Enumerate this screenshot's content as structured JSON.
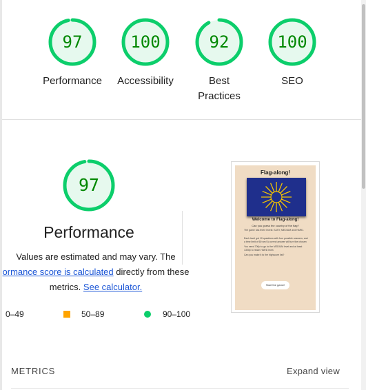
{
  "summary": {
    "gauges": [
      {
        "score": "97",
        "label": "Performance",
        "fraction": 0.97
      },
      {
        "score": "100",
        "label": "Accessibility",
        "fraction": 1.0
      },
      {
        "score": "92",
        "label": "Best Practices",
        "fraction": 0.92
      },
      {
        "score": "100",
        "label": "SEO",
        "fraction": 1.0
      }
    ]
  },
  "performance": {
    "score": "97",
    "fraction": 0.97,
    "title": "Performance",
    "desc_line1": "Values are estimated and may vary. The",
    "desc_link1": "ormance score is calculated",
    "desc_line2_rest": " directly from these",
    "desc_line3_pre": "metrics. ",
    "desc_link2": "See calculator."
  },
  "legend": {
    "fail": "0–49",
    "average": "50–89",
    "pass": "90–100"
  },
  "screenshot": {
    "title": "Flag-along!",
    "welcome": "Welcome to Flag-along!",
    "question": "Can you guess the country of the flag?",
    "bullets": [
      "The game has three levels: EASY, MEDIUM and HARD.",
      "Each level got 10 questions with four possible answers, and a time limit of 60 sec! A correct answer will turn the chosen button green.",
      "You need 700p to go to the MEDIUM level and at least 1300p to reach HARD level.",
      "Can you make it to the highscore list?"
    ],
    "button": "Start the game!"
  },
  "metrics": {
    "label": "METRICS",
    "expand": "Expand view"
  },
  "colors": {
    "pass": "#0cce6b",
    "pass_text": "#008800",
    "pass_bg": "#e6f9ee",
    "average": "#ffa400",
    "link": "#1a55d6"
  }
}
